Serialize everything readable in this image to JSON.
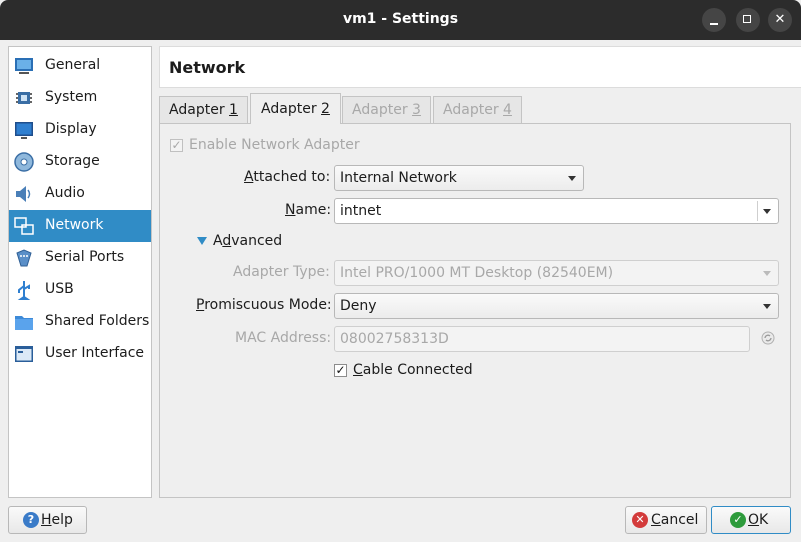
{
  "window": {
    "title": "vm1 - Settings",
    "controls": [
      "minimize",
      "maximize",
      "close"
    ]
  },
  "sidebar": {
    "items": [
      {
        "label": "General",
        "icon": "general-icon"
      },
      {
        "label": "System",
        "icon": "system-chip-icon"
      },
      {
        "label": "Display",
        "icon": "display-monitor-icon"
      },
      {
        "label": "Storage",
        "icon": "storage-disk-icon"
      },
      {
        "label": "Audio",
        "icon": "audio-speaker-icon"
      },
      {
        "label": "Network",
        "icon": "network-icon"
      },
      {
        "label": "Serial Ports",
        "icon": "serial-ports-icon"
      },
      {
        "label": "USB",
        "icon": "usb-icon"
      },
      {
        "label": "Shared Folders",
        "icon": "shared-folder-icon"
      },
      {
        "label": "User Interface",
        "icon": "user-interface-icon"
      }
    ],
    "selected": "Network"
  },
  "page_title": "Network",
  "tabs": [
    {
      "pre": "Adapter ",
      "key": "1",
      "state": "normal"
    },
    {
      "pre": "Adapter ",
      "key": "2",
      "state": "selected"
    },
    {
      "pre": "Adapter ",
      "key": "3",
      "state": "disabled"
    },
    {
      "pre": "Adapter ",
      "key": "4",
      "state": "disabled"
    }
  ],
  "form": {
    "enable_adapter": {
      "label": "Enable Network Adapter",
      "checked": true,
      "disabled": true
    },
    "attached_to": {
      "label_key": "A",
      "label_rest": "ttached to:",
      "value": "Internal Network"
    },
    "name": {
      "label_key": "N",
      "label_rest": "ame:",
      "value": "intnet"
    },
    "advanced": {
      "label_key": "d",
      "label_pre": "A",
      "label_rest": "vanced"
    },
    "adapter_type": {
      "label": "Adapter Type:",
      "value": "Intel PRO/1000 MT Desktop (82540EM)",
      "disabled": true
    },
    "promiscuous_mode": {
      "label_key": "P",
      "label_rest": "romiscuous Mode:",
      "value": "Deny"
    },
    "mac_address": {
      "label": "MAC Address:",
      "value": "08002758313D",
      "disabled": true
    },
    "cable_connected": {
      "label_key": "C",
      "label_rest": "able Connected",
      "checked": true
    }
  },
  "buttons": {
    "help": {
      "key": "H",
      "rest": "elp",
      "icon": "help-icon"
    },
    "cancel": {
      "key": "C",
      "rest": "ancel",
      "icon": "cancel-icon"
    },
    "ok": {
      "key": "O",
      "rest": "K",
      "icon": "ok-check-icon"
    }
  },
  "colors": {
    "accent": "#308cc6",
    "titlebar": "#2c2c2c",
    "cancel_icon": "#d33b3b",
    "ok_icon": "#2e9b3c"
  }
}
